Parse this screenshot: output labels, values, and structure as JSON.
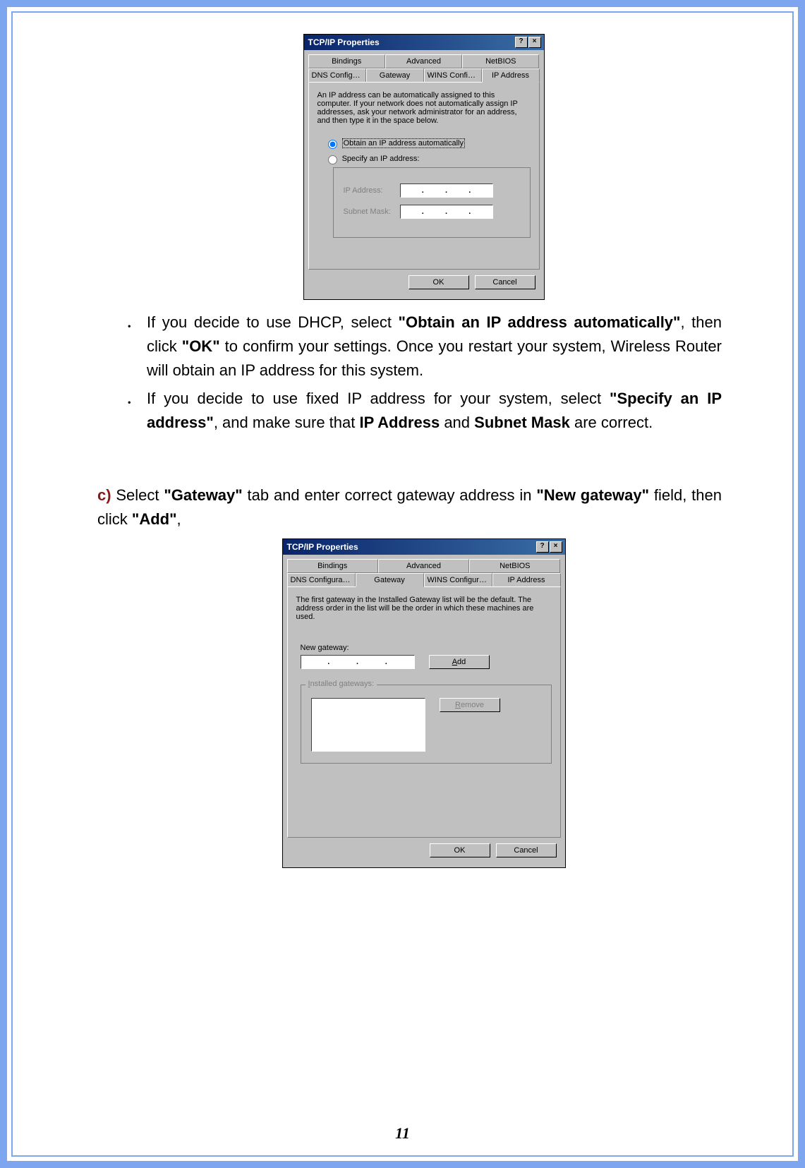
{
  "page_number": "11",
  "dialog1": {
    "title": "TCP/IP Properties",
    "tabs_row1": [
      "Bindings",
      "Advanced",
      "NetBIOS"
    ],
    "tabs_row2": [
      "DNS Configuration",
      "Gateway",
      "WINS Configuration",
      "IP Address"
    ],
    "active_tab": "IP Address",
    "description": "An IP address can be automatically assigned to this computer. If your network does not automatically assign IP addresses, ask your network administrator for an address, and then type it in the space below.",
    "radio1": "Obtain an IP address automatically",
    "radio2": "Specify an IP address:",
    "ip_address_label": "IP Address:",
    "subnet_mask_label": "Subnet Mask:",
    "ok_label": "OK",
    "cancel_label": "Cancel"
  },
  "bullets": {
    "b1_part1": "If you decide to use DHCP, select ",
    "b1_bold1": "\"Obtain an IP address automatically\"",
    "b1_part2": ", then click ",
    "b1_bold2": "\"OK\"",
    "b1_part3": " to confirm your settings. Once you restart your system, Wireless Router will obtain an IP address for this system.",
    "b2_part1": "If you decide to use fixed IP address for your system, select ",
    "b2_bold1": "\"Specify an IP address\"",
    "b2_part2": ", and make sure that ",
    "b2_bold2": "IP Address",
    "b2_part3": " and ",
    "b2_bold3": "Subnet Mask",
    "b2_part4": " are correct."
  },
  "step_c": {
    "label": "c)",
    "part1": " Select ",
    "bold1": "\"Gateway\"",
    "part2": " tab and enter correct gateway address in ",
    "bold2": "\"New gateway\"",
    "part3": " field, then click ",
    "bold3": "\"Add\"",
    "part4": ","
  },
  "dialog2": {
    "title": "TCP/IP Properties",
    "tabs_row1": [
      "Bindings",
      "Advanced",
      "NetBIOS"
    ],
    "tabs_row2": [
      "DNS Configuration",
      "Gateway",
      "WINS Configuration",
      "IP Address"
    ],
    "active_tab": "Gateway",
    "description": "The first gateway in the Installed Gateway list will be the default. The address order in the list will be the order in which these machines are used.",
    "new_gateway_label": "New gateway:",
    "add_label": "Add",
    "installed_label": "Installed gateways:",
    "remove_label": "Remove",
    "ok_label": "OK",
    "cancel_label": "Cancel"
  }
}
